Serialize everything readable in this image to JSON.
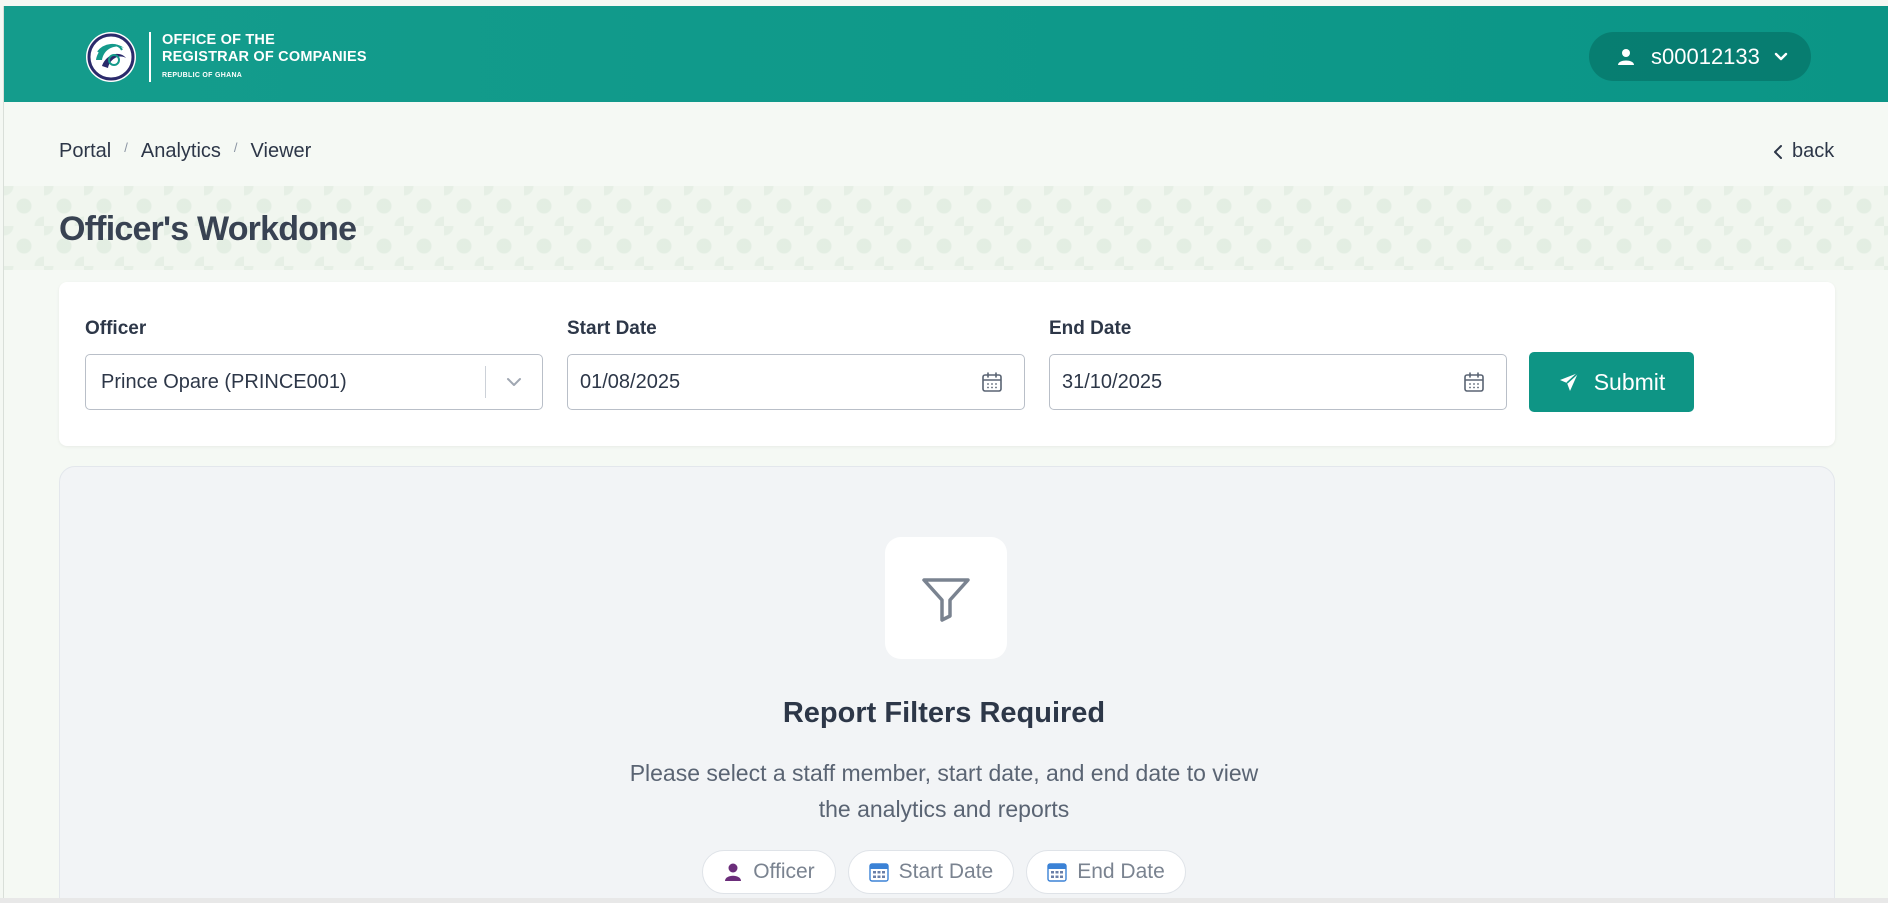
{
  "header": {
    "logo_line1": "OFFICE OF THE",
    "logo_line2": "REGISTRAR OF COMPANIES",
    "logo_line3": "REPUBLIC OF GHANA",
    "user_id": "s00012133"
  },
  "breadcrumb": {
    "items": [
      "Portal",
      "Analytics",
      "Viewer"
    ],
    "separator": "/"
  },
  "back_label": "back",
  "page_title": "Officer's Workdone",
  "filters": {
    "officer_label": "Officer",
    "officer_value": "Prince Opare (PRINCE001)",
    "start_label": "Start Date",
    "start_value": "01/08/2025",
    "end_label": "End Date",
    "end_value": "31/10/2025",
    "submit_label": "Submit"
  },
  "empty_state": {
    "icon": "filter-icon",
    "title": "Report Filters Required",
    "desc_line1": "Please select a staff member, start date, and end date to view",
    "desc_line2": "the analytics and reports",
    "chips": [
      "Officer",
      "Start Date",
      "End Date"
    ]
  },
  "colors": {
    "brand": "#0e9585",
    "header_bg": "#149c8c",
    "chip_officer_icon": "#6b2d7a",
    "chip_date_icon": "#3b82d6"
  }
}
